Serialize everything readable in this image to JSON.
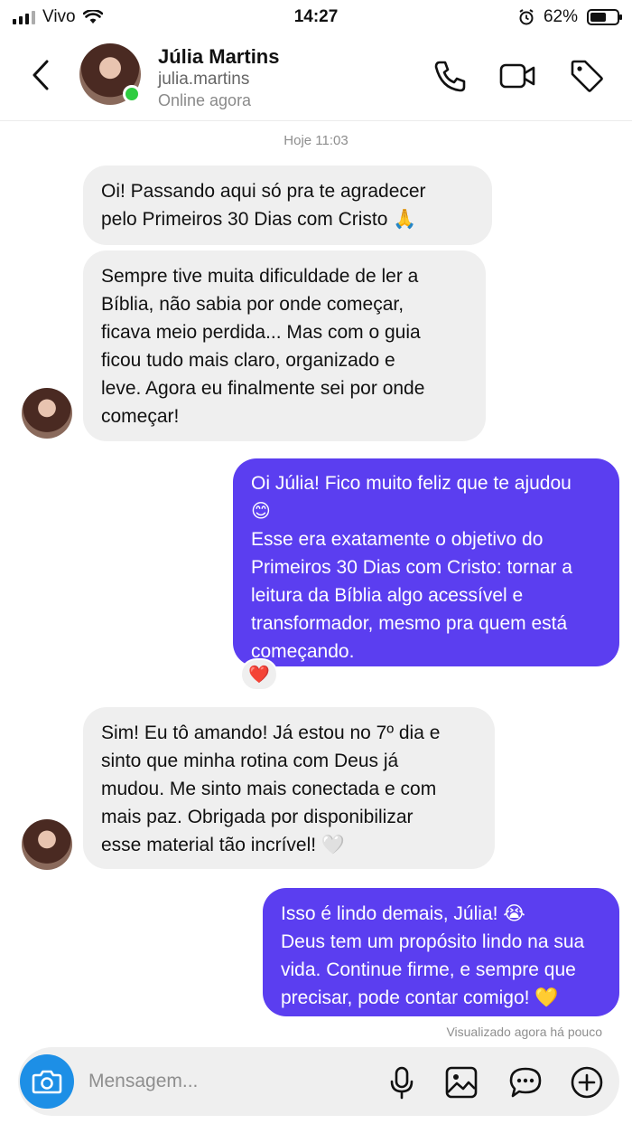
{
  "status_bar": {
    "carrier": "Vivo",
    "time": "14:27",
    "battery_percent": "62%",
    "battery_level": 0.62
  },
  "header": {
    "name": "Júlia Martins",
    "handle": "julia.martins",
    "status": "Online agora",
    "icons": [
      "back-arrow-icon",
      "phone-icon",
      "video-camera-icon",
      "tag-icon"
    ]
  },
  "chat": {
    "day_label": "Hoje 11:03",
    "messages": [
      {
        "lines": [
          "Oi! Passando aqui só pra te agradecer",
          "pelo Primeiros 30 Dias com Cristo 🙏"
        ]
      },
      {
        "lines": [
          "Sempre tive muita dificuldade de ler a",
          "Bíblia, não sabia por onde começar,",
          "ficava meio perdida... Mas com o guia",
          "ficou tudo mais claro, organizado e",
          "leve. Agora eu finalmente sei por onde",
          "começar!"
        ]
      },
      {
        "lines": [
          "Oi Júlia! Fico muito feliz que te ajudou",
          "😊",
          "Esse era exatamente o objetivo do",
          "Primeiros 30 Dias com Cristo: tornar a",
          "leitura da Bíblia algo acessível e",
          "transformador, mesmo pra quem está",
          "começando."
        ]
      },
      {
        "lines": [
          "Sim! Eu tô amando! Já estou no 7º dia e",
          "sinto que minha rotina com Deus já",
          "mudou. Me sinto mais conectada e com",
          "mais paz. Obrigada por disponibilizar",
          "esse material tão incrível! 🤍"
        ]
      },
      {
        "lines": [
          "Isso é lindo demais, Júlia! 😭",
          "Deus tem um propósito lindo na sua",
          "vida. Continue firme, e sempre que",
          "precisar, pode contar comigo! 💛"
        ]
      }
    ],
    "reaction": "❤️",
    "seen_label": "Visualizado agora há pouco"
  },
  "composer": {
    "placeholder": "Mensagem...",
    "icons": [
      "camera-icon",
      "microphone-icon",
      "gallery-icon",
      "sticker-icon",
      "add-icon"
    ]
  },
  "colors": {
    "outgoing_bubble": "#5b3ef0",
    "incoming_bubble": "#efefef",
    "camera_button": "#1d8fe6",
    "online_dot": "#2ecc40"
  }
}
